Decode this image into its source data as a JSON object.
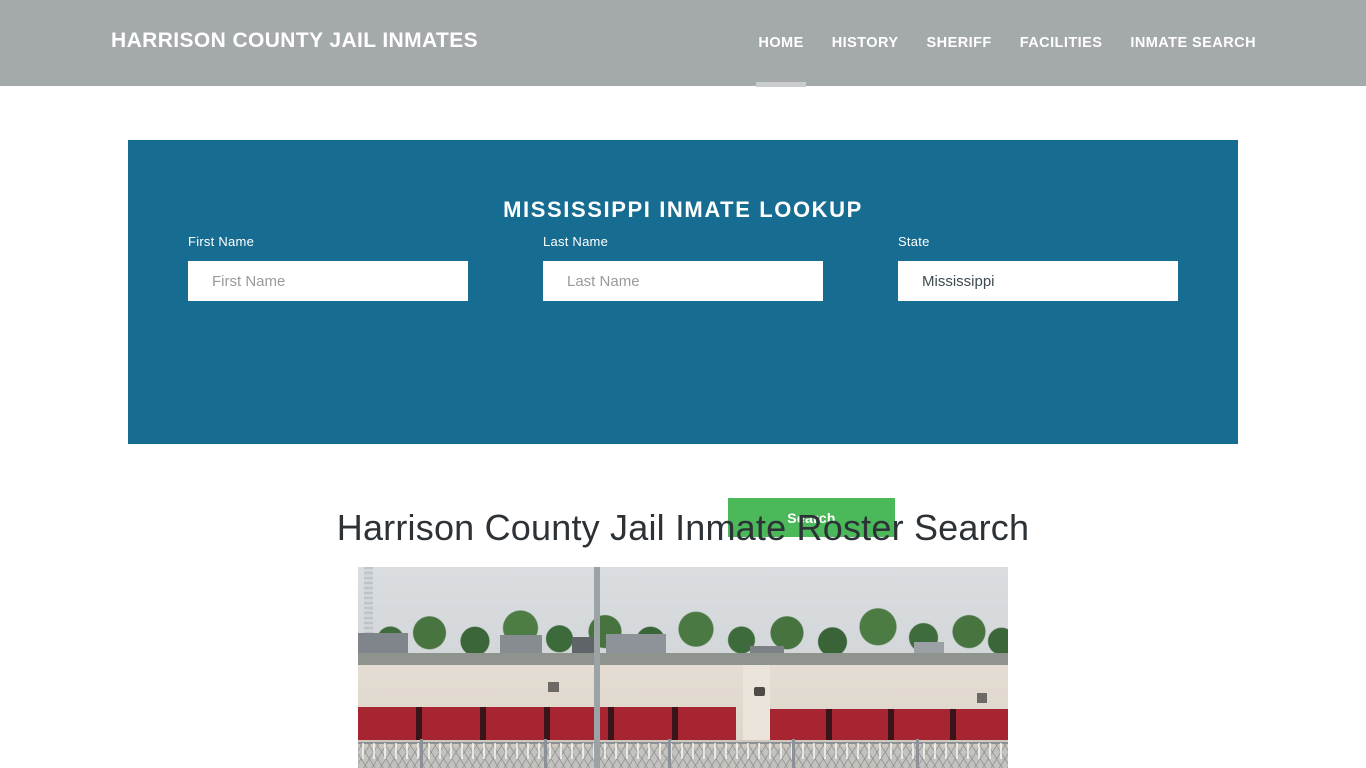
{
  "header": {
    "brand": "Harrison County Jail Inmates",
    "nav": [
      {
        "label": "Home",
        "active": true
      },
      {
        "label": "History",
        "active": false
      },
      {
        "label": "Sheriff",
        "active": false
      },
      {
        "label": "Facilities",
        "active": false
      },
      {
        "label": "Inmate Search",
        "active": false
      }
    ],
    "background_color": "#a4a9ac",
    "text_color": "#ffffff"
  },
  "lookup": {
    "title": "Mississippi Inmate Lookup",
    "panel_color": "#166c91",
    "fields": {
      "first_name": {
        "label": "First Name",
        "placeholder": "First Name",
        "value": ""
      },
      "last_name": {
        "label": "Last Name",
        "placeholder": "Last Name",
        "value": ""
      },
      "state": {
        "label": "State",
        "selected": "Mississippi",
        "options": [
          "Mississippi"
        ]
      }
    },
    "search_button": {
      "label": "Search",
      "color": "#4bb85a"
    }
  },
  "main": {
    "heading": "Harrison County Jail Inmate Roster Search",
    "photo_alt": "Harrison County Jail facility exterior with red panels and razor wire fence"
  }
}
